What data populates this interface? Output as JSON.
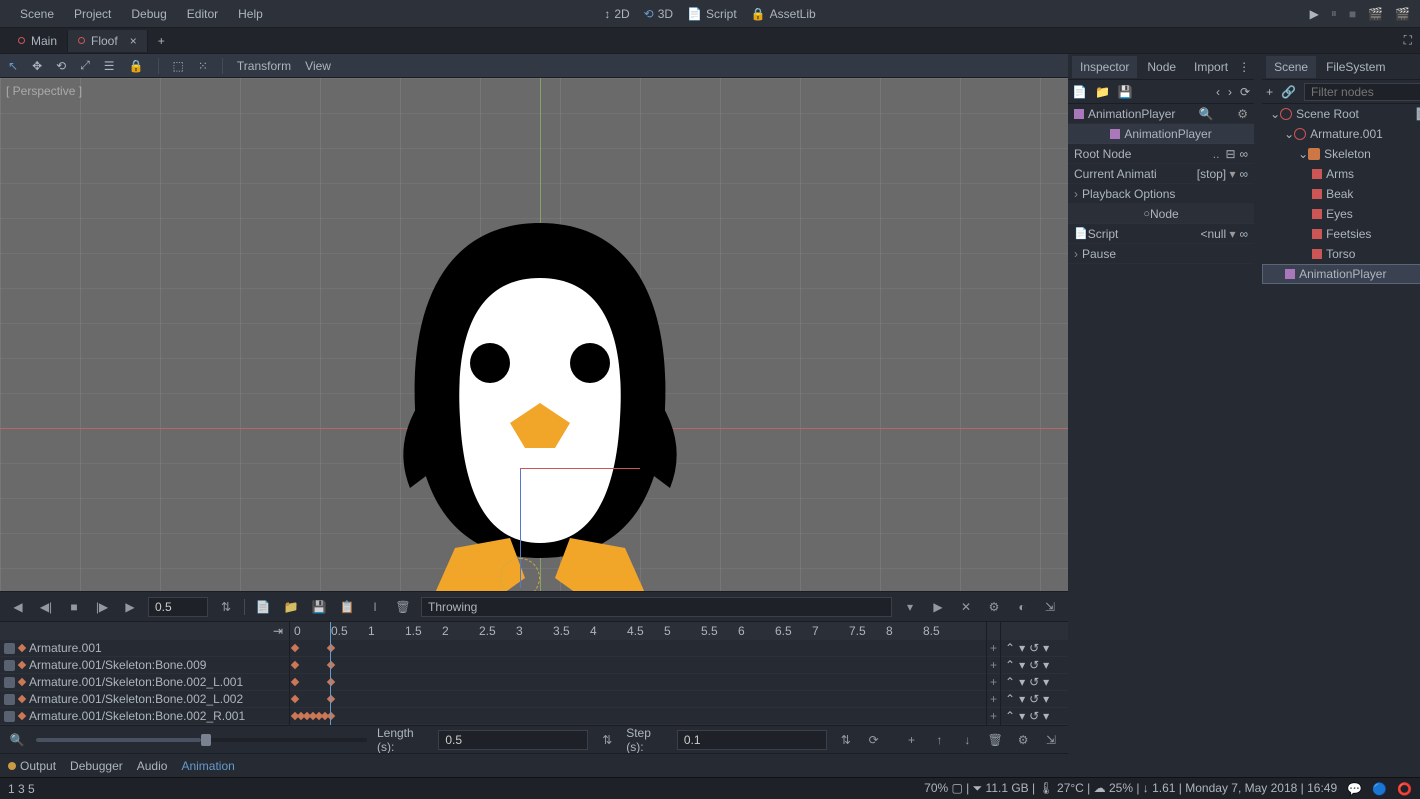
{
  "menubar": {
    "items": [
      "Scene",
      "Project",
      "Debug",
      "Editor",
      "Help"
    ],
    "center": {
      "two_d": "2D",
      "three_d": "3D",
      "script": "Script",
      "assetlib": "AssetLib"
    }
  },
  "tabs": {
    "items": [
      {
        "label": "Main"
      },
      {
        "label": "Floof",
        "active": true
      }
    ]
  },
  "toolbar": {
    "transform": "Transform",
    "view": "View"
  },
  "viewport": {
    "label": "[ Perspective ]"
  },
  "anim": {
    "position": "0.5",
    "name": "Throwing",
    "ruler": [
      "0",
      "0.5",
      "1",
      "1.5",
      "2",
      "2.5",
      "3",
      "3.5",
      "4",
      "4.5",
      "5",
      "5.5",
      "6",
      "6.5",
      "7",
      "7.5",
      "8",
      "8.5"
    ],
    "tracks": [
      "Armature.001",
      "Armature.001/Skeleton:Bone.009",
      "Armature.001/Skeleton:Bone.002_L.001",
      "Armature.001/Skeleton:Bone.002_L.002",
      "Armature.001/Skeleton:Bone.002_R.001"
    ],
    "length_label": "Length (s):",
    "length": "0.5",
    "step_label": "Step (s):",
    "step": "0.1"
  },
  "bottom_tabs": {
    "output": "Output",
    "debugger": "Debugger",
    "audio": "Audio",
    "animation": "Animation"
  },
  "inspector": {
    "tabs": {
      "inspector": "Inspector",
      "node": "Node",
      "import": "Import"
    },
    "title": "AnimationPlayer",
    "typebox": "AnimationPlayer",
    "root_label": "Root Node",
    "root_value": "..",
    "currentanim_label": "Current Animati",
    "currentanim_value": "[stop]",
    "playback": "Playback Options",
    "node": "Node",
    "script_label": "Script",
    "script_value": "<null",
    "pause": "Pause"
  },
  "scene": {
    "tabs": {
      "scene": "Scene",
      "filesystem": "FileSystem"
    },
    "filter_placeholder": "Filter nodes",
    "nodes": [
      {
        "name": "Scene Root",
        "type": "sp",
        "ind": 0,
        "exp": "⌄"
      },
      {
        "name": "Armature.001",
        "type": "sp",
        "ind": 1,
        "exp": "⌄"
      },
      {
        "name": "Skeleton",
        "type": "sk",
        "ind": 2,
        "exp": "⌄"
      },
      {
        "name": "Arms",
        "type": "bn",
        "ind": 3
      },
      {
        "name": "Beak",
        "type": "bn",
        "ind": 3
      },
      {
        "name": "Eyes",
        "type": "bn",
        "ind": 3
      },
      {
        "name": "Feetsies",
        "type": "bn",
        "ind": 3
      },
      {
        "name": "Torso",
        "type": "bn",
        "ind": 3
      },
      {
        "name": "AnimationPlayer",
        "type": "ap",
        "ind": 1,
        "sel": true
      }
    ]
  },
  "status": {
    "left": "1  3  5",
    "right": "70% ▢ | ⏷ 11.1 GB | 🌡 27°C | ☁ 25% | ↓ 1.61 | Monday  7, May 2018 | 16:49"
  }
}
